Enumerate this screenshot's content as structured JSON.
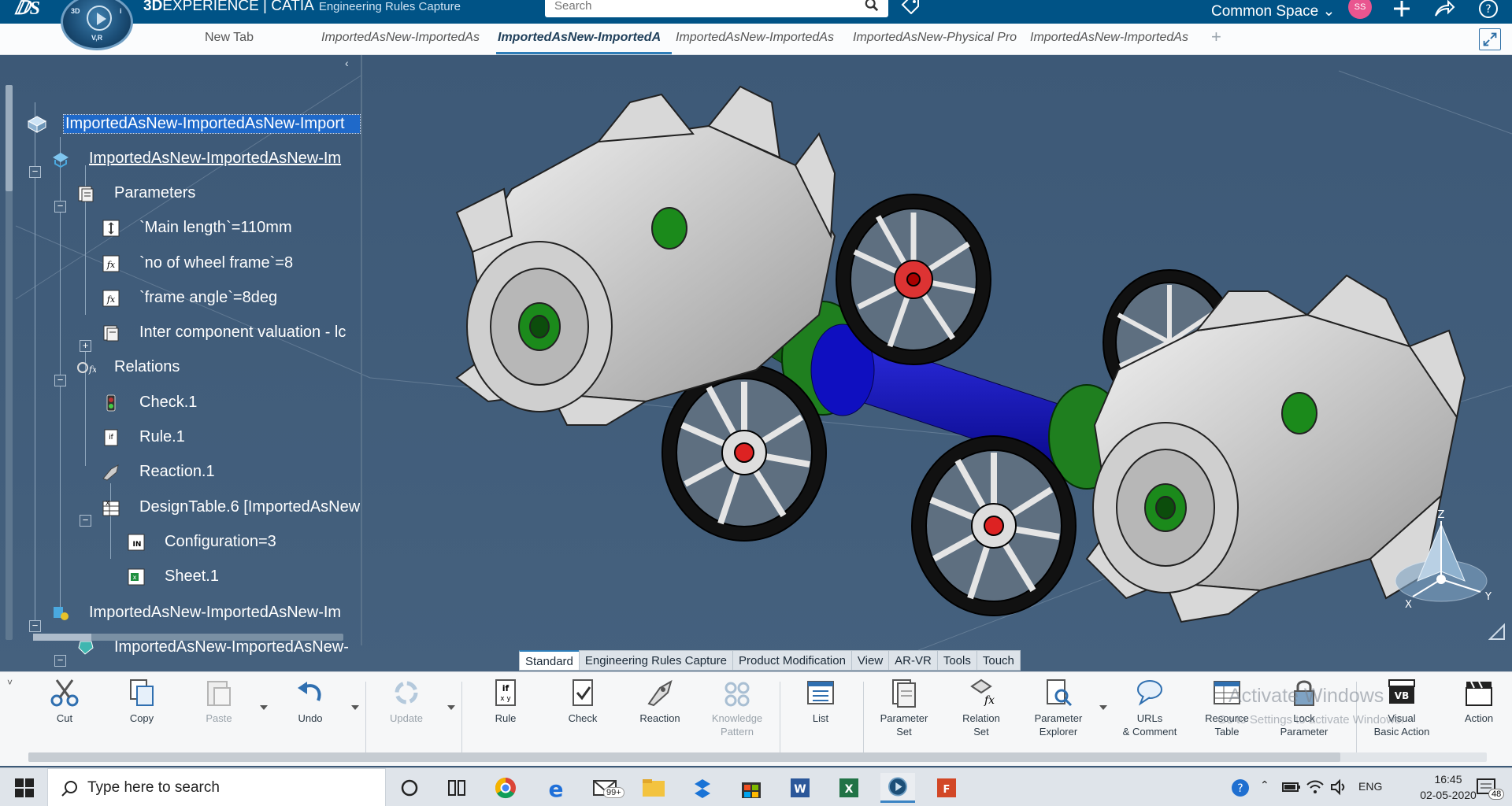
{
  "topbar": {
    "brand_bold": "3D",
    "brand": "EXPERIENCE | CATIA",
    "app_name": "Engineering Rules Capture",
    "search_placeholder": "Search",
    "space": "Common Space",
    "avatar_initials": "SS",
    "compass": {
      "top_left": "3D",
      "top_right": "i",
      "bottom": "V,R"
    }
  },
  "tabs": [
    {
      "label": "New Tab"
    },
    {
      "label": "ImportedAsNew-ImportedAs"
    },
    {
      "label": "ImportedAsNew-ImportedA"
    },
    {
      "label": "ImportedAsNew-ImportedAs"
    },
    {
      "label": "ImportedAsNew-Physical Pro"
    },
    {
      "label": "ImportedAsNew-ImportedAs"
    }
  ],
  "tab_add": "+",
  "tree": {
    "collapse": "‹",
    "nodes": [
      {
        "label": "ImportedAsNew-ImportedAsNew-Import"
      },
      {
        "label": "ImportedAsNew-ImportedAsNew-Im"
      },
      {
        "label": "Parameters"
      },
      {
        "label": "`Main length`=110mm"
      },
      {
        "label": "`no of wheel frame`=8"
      },
      {
        "label": "`frame angle`=8deg"
      },
      {
        "label": "Inter component valuation - lc"
      },
      {
        "label": "Relations"
      },
      {
        "label": "Check.1"
      },
      {
        "label": "Rule.1"
      },
      {
        "label": "Reaction.1"
      },
      {
        "label": "DesignTable.6 [ImportedAsNew"
      },
      {
        "label": "Configuration=3"
      },
      {
        "label": "Sheet.1"
      },
      {
        "label": "ImportedAsNew-ImportedAsNew-Im"
      },
      {
        "label": "ImportedAsNew-ImportedAsNew-"
      }
    ]
  },
  "axis": {
    "z": "Z",
    "x": "X",
    "y": "Y"
  },
  "workbench_tabs": [
    "Standard",
    "Engineering Rules Capture",
    "Product Modification",
    "View",
    "AR-VR",
    "Tools",
    "Touch"
  ],
  "ribbon": {
    "collapse": "˅",
    "cut": "Cut",
    "copy": "Copy",
    "paste": "Paste",
    "undo": "Undo",
    "update": "Update",
    "rule": "Rule",
    "check": "Check",
    "reaction": "Reaction",
    "knowledge_pattern": "Knowledge\nPattern",
    "list": "List",
    "parameter_set": "Parameter\nSet",
    "relation_set": "Relation\nSet",
    "parameter_explorer": "Parameter\nExplorer",
    "urls_comment": "URLs\n& Comment",
    "resource_table": "Resource\nTable",
    "lock_parameter": "Lock\nParameter",
    "visual_basic_action": "Visual\nBasic Action",
    "action": "Action"
  },
  "watermark": {
    "line1": "Activate Windows",
    "line2": "Go to Settings to activate Windows."
  },
  "taskbar": {
    "search_placeholder": "Type here to search",
    "mail_badge": "99+",
    "language": "ENG",
    "time": "16:45",
    "date": "02-05-2020",
    "notifications": "48"
  },
  "colors": {
    "titlebar": "#005386",
    "viewport": "#3f5b78",
    "selection": "#1f69c9",
    "accent": "#2e7db8"
  }
}
